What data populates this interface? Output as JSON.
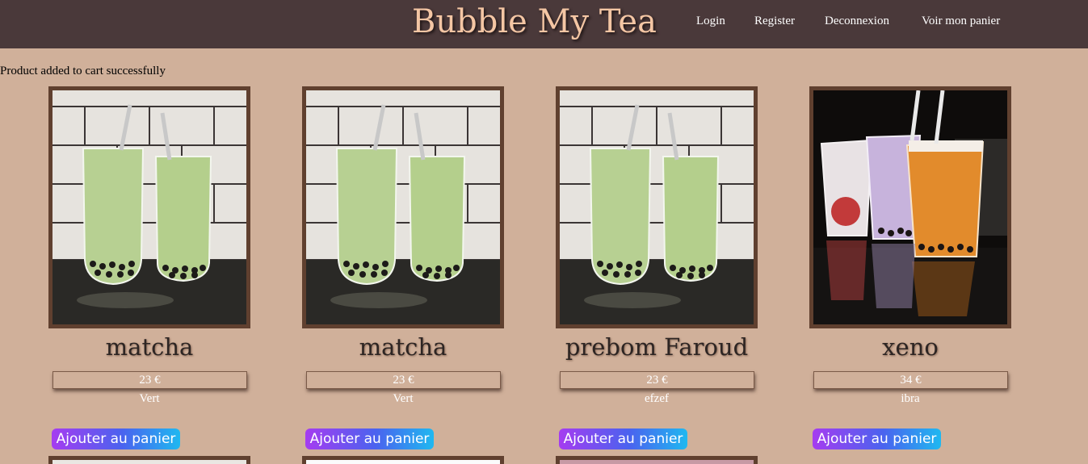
{
  "header": {
    "brand": "Bubble My Tea",
    "nav": [
      "Login",
      "Register",
      "Deconnexion",
      "Voir mon panier"
    ]
  },
  "flash_message": "Product added to cart successfully",
  "products": [
    {
      "name": "matcha",
      "price": "23 €",
      "description": "Vert",
      "image": "matcha-bubble-tea-image",
      "button": "Ajouter au panier"
    },
    {
      "name": "matcha",
      "price": "23 €",
      "description": "Vert",
      "image": "matcha-bubble-tea-image",
      "button": "Ajouter au panier"
    },
    {
      "name": "prebom Faroud",
      "price": "23 €",
      "description": "efzef",
      "image": "matcha-bubble-tea-image",
      "button": "Ajouter au panier"
    },
    {
      "name": "xeno",
      "price": "34 €",
      "description": "ibra",
      "image": "assorted-bubble-tea-image",
      "button": "Ajouter au panier"
    }
  ],
  "colors": {
    "header_bg": "#4a393a",
    "brand": "#f4c6a4",
    "page_bg": "#d0b09a",
    "frame_border": "#60402f",
    "button_gradient": [
      "#a53cf0",
      "#4a63ef",
      "#1fb8f0"
    ]
  }
}
